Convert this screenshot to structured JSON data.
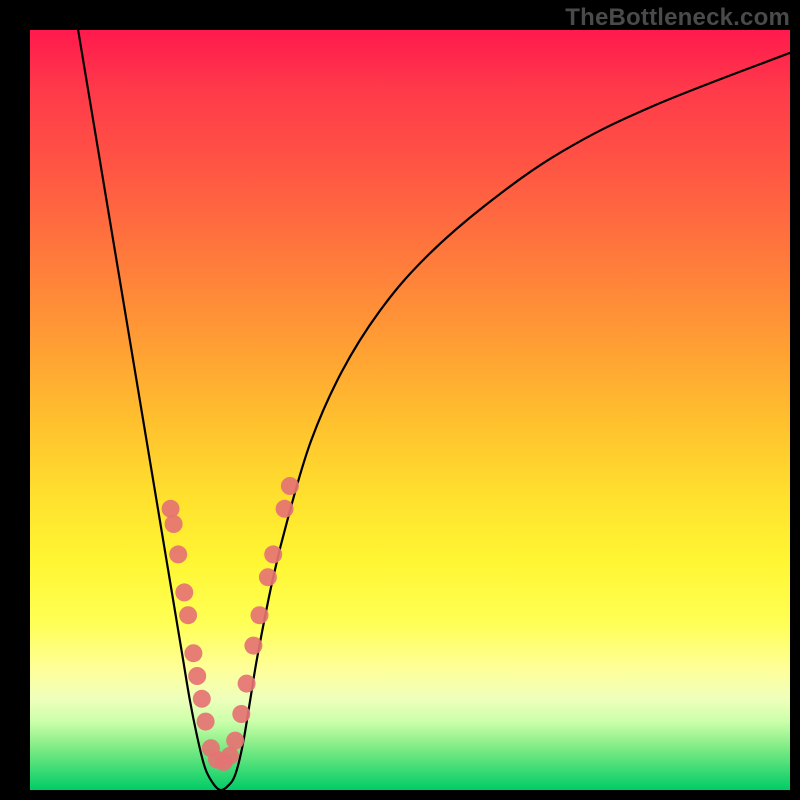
{
  "attribution": "TheBottleneck.com",
  "chart_data": {
    "type": "line",
    "title": "",
    "xlabel": "",
    "ylabel": "",
    "xlim": [
      0,
      100
    ],
    "ylim": [
      0,
      100
    ],
    "grid": false,
    "legend": false,
    "gradient_bands": [
      {
        "name": "red",
        "approx_y_pct": 0
      },
      {
        "name": "orange",
        "approx_y_pct": 40
      },
      {
        "name": "yellow",
        "approx_y_pct": 75
      },
      {
        "name": "green",
        "approx_y_pct": 100
      }
    ],
    "series": [
      {
        "name": "bottleneck-curve",
        "color": "#000000",
        "x": [
          6,
          8,
          10,
          12,
          14,
          16,
          18,
          20,
          21,
          22,
          23,
          24,
          25,
          26,
          27,
          28,
          29,
          30,
          32,
          34,
          37,
          41,
          46,
          52,
          60,
          70,
          82,
          100
        ],
        "y": [
          102,
          90,
          78,
          66,
          54,
          42,
          30,
          18,
          12,
          7,
          3,
          1,
          0,
          0.5,
          2,
          6,
          12,
          18,
          28,
          36,
          46,
          55,
          63,
          70,
          77,
          84,
          90,
          97
        ]
      }
    ],
    "marker_clusters": [
      {
        "name": "left-branch-markers",
        "color": "#e57373",
        "points": [
          {
            "x": 18.5,
            "y_pct_from_top": 63
          },
          {
            "x": 18.9,
            "y_pct_from_top": 65
          },
          {
            "x": 19.5,
            "y_pct_from_top": 69
          },
          {
            "x": 20.3,
            "y_pct_from_top": 74
          },
          {
            "x": 20.8,
            "y_pct_from_top": 77
          },
          {
            "x": 21.5,
            "y_pct_from_top": 82
          },
          {
            "x": 22.0,
            "y_pct_from_top": 85
          },
          {
            "x": 22.6,
            "y_pct_from_top": 88
          },
          {
            "x": 23.1,
            "y_pct_from_top": 91
          }
        ]
      },
      {
        "name": "valley-markers",
        "color": "#e57373",
        "points": [
          {
            "x": 23.8,
            "y_pct_from_top": 94.5
          },
          {
            "x": 24.6,
            "y_pct_from_top": 96
          },
          {
            "x": 25.5,
            "y_pct_from_top": 96.3
          },
          {
            "x": 26.3,
            "y_pct_from_top": 95.5
          },
          {
            "x": 27.0,
            "y_pct_from_top": 93.5
          }
        ]
      },
      {
        "name": "right-branch-markers",
        "color": "#e57373",
        "points": [
          {
            "x": 27.8,
            "y_pct_from_top": 90
          },
          {
            "x": 28.5,
            "y_pct_from_top": 86
          },
          {
            "x": 29.4,
            "y_pct_from_top": 81
          },
          {
            "x": 30.2,
            "y_pct_from_top": 77
          },
          {
            "x": 31.3,
            "y_pct_from_top": 72
          },
          {
            "x": 32.0,
            "y_pct_from_top": 69
          },
          {
            "x": 33.5,
            "y_pct_from_top": 63
          },
          {
            "x": 34.2,
            "y_pct_from_top": 60
          }
        ]
      }
    ]
  }
}
